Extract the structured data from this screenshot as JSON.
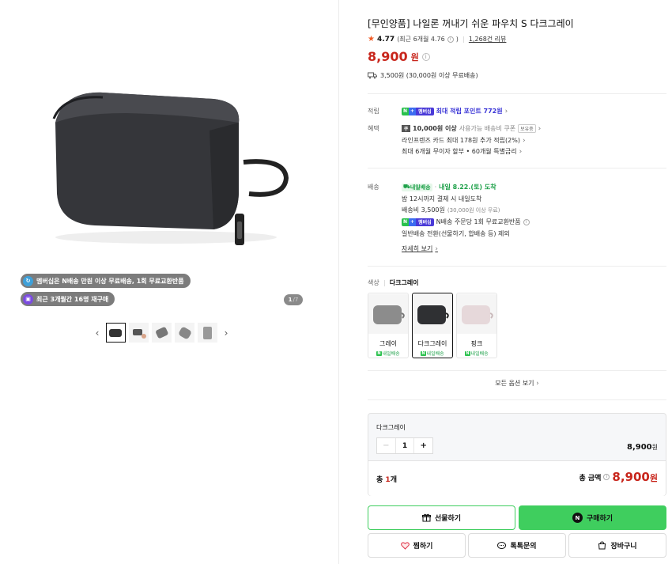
{
  "gallery": {
    "badge_membership": "멤버십은 N배송 만원 이상 무료배송, 1회 무료교환반품",
    "badge_repurchase": "최근 3개월간 16명 재구매",
    "counter_current": "1",
    "counter_total": "/7"
  },
  "product": {
    "title": "[무인양품] 나일론 꺼내기 쉬운 파우치 S 다크그레이",
    "rating_score": "4.77",
    "rating_recent": "(최근 6개월 4.76",
    "rating_recent_close": ")",
    "review_count": "1,268건 리뷰",
    "price": "8,900",
    "price_unit": "원",
    "shipping": "3,500원 (30,000원 이상 무료배송)"
  },
  "benefits": {
    "point_label": "적립",
    "n_label": "N",
    "plus_label": "+",
    "membership_label": "멤버십",
    "point_text": "최대 적립 포인트 772원",
    "benefit_label": "혜택",
    "coupon_icon": "쿠",
    "coupon_amount": "10,000원 이상",
    "coupon_text": "사용가능 배송비 쿠폰",
    "coupon_tag": "보유중",
    "card_text": "라인프렌즈 카드 최대 178원 추가 적립(2%)",
    "installment_text": "최대 6개월 무이자 할부 • 60개월 특별금리"
  },
  "delivery": {
    "label": "배송",
    "tomorrow_badge": "내일배송",
    "tomorrow_date": "내일 8.22.(토) 도착",
    "line1": "밤 12시까지 결제 시 내일도착",
    "fee": "배송비 3,500원",
    "fee_note": "(30,000원 이상 무료)",
    "nreturn": "N배송 주문당 1회 무료교환반품",
    "general": "일반배송 전환(선물하기, 합배송 등) 제외",
    "more": "자세히 보기"
  },
  "options": {
    "label": "색상",
    "selected": "다크그레이",
    "items": [
      {
        "name": "그레이",
        "delivery": "내일배송",
        "color": "#8c8c8c"
      },
      {
        "name": "다크그레이",
        "delivery": "내일배송",
        "color": "#2f3033"
      },
      {
        "name": "핑크",
        "delivery": "내일배송",
        "color": "#e6d8da"
      }
    ],
    "all_label": "모든 옵션 보기"
  },
  "selection": {
    "name": "다크그레이",
    "qty": "1",
    "line_price": "8,900",
    "line_unit": "원",
    "total_label": "총",
    "total_count": "1",
    "total_count_unit": "개",
    "total_amount_label": "총 금액",
    "total_amount": "8,900",
    "total_unit": "원"
  },
  "actions": {
    "gift": "선물하기",
    "buy": "구매하기",
    "zzim": "찜하기",
    "talk": "톡톡문의",
    "cart": "장바구니"
  },
  "colors": {
    "accent_green": "#3fce5e",
    "price_red": "#c8261c"
  }
}
